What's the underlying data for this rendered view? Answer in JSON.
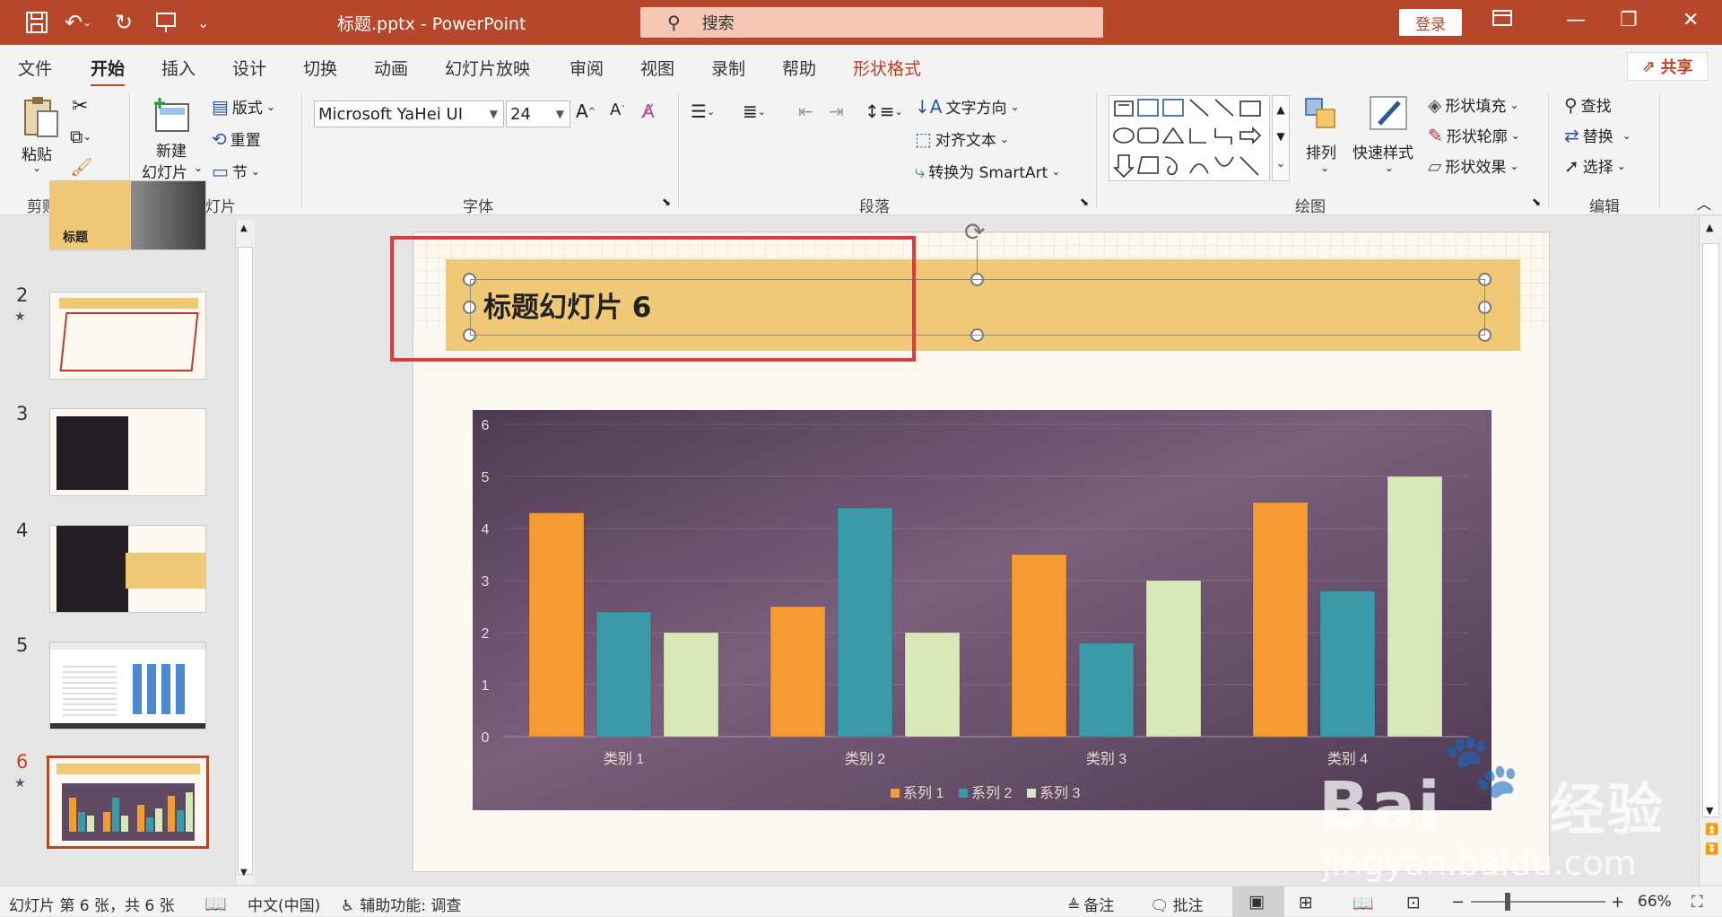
{
  "titlebar": {
    "document_title": "标题.pptx  -  PowerPoint",
    "search_placeholder": "搜索",
    "login_label": "登录"
  },
  "menu": {
    "tabs": [
      "文件",
      "开始",
      "插入",
      "设计",
      "切换",
      "动画",
      "幻灯片放映",
      "审阅",
      "视图",
      "录制",
      "帮助",
      "形状格式"
    ],
    "active_tab": "开始",
    "share_label": "共享"
  },
  "ribbon": {
    "clipboard": {
      "label": "剪贴板",
      "paste": "粘贴"
    },
    "slides": {
      "label": "幻灯片",
      "new_slide_line1": "新建",
      "new_slide_line2": "幻灯片",
      "layout": "版式",
      "reset": "重置",
      "section": "节"
    },
    "font": {
      "label": "字体",
      "font_name": "Microsoft YaHei UI",
      "font_size": "24"
    },
    "paragraph": {
      "label": "段落",
      "text_direction": "文字方向",
      "align_text": "对齐文本",
      "convert_smartart": "转换为 SmartArt"
    },
    "drawing": {
      "label": "绘图",
      "arrange": "排列",
      "quick_styles": "快速样式",
      "shape_fill": "形状填充",
      "shape_outline": "形状轮廓",
      "shape_effects": "形状效果"
    },
    "editing": {
      "label": "编辑",
      "find": "查找",
      "replace": "替换",
      "select": "选择"
    }
  },
  "slides_panel": {
    "numbers": [
      "2",
      "3",
      "4",
      "5",
      "6"
    ],
    "thumb1_title": "标题",
    "selected": "6"
  },
  "slide": {
    "title": "标题幻灯片 6"
  },
  "chart_data": {
    "type": "bar",
    "categories": [
      "类别 1",
      "类别 2",
      "类别 3",
      "类别 4"
    ],
    "series": [
      {
        "name": "系列 1",
        "values": [
          4.3,
          2.5,
          3.5,
          4.5
        ],
        "color": "#f59b32"
      },
      {
        "name": "系列 2",
        "values": [
          2.4,
          4.4,
          1.8,
          2.8
        ],
        "color": "#3a9aa8"
      },
      {
        "name": "系列 3",
        "values": [
          2.0,
          2.0,
          3.0,
          5.0
        ],
        "color": "#d9e8b8"
      }
    ],
    "ylim": [
      0,
      6
    ],
    "yticks": [
      "0",
      "1",
      "2",
      "3",
      "4",
      "5",
      "6"
    ],
    "grid": true,
    "legend": "bottom"
  },
  "statusbar": {
    "slide_info": "幻灯片 第 6 张，共 6 张",
    "language": "中文(中国)",
    "accessibility": "辅助功能: 调查",
    "notes": "备注",
    "comments": "批注",
    "zoom": "66%"
  },
  "watermark": {
    "brand": "Bai",
    "brand_cn": "经验",
    "url": "jingyan.baidu.com"
  }
}
